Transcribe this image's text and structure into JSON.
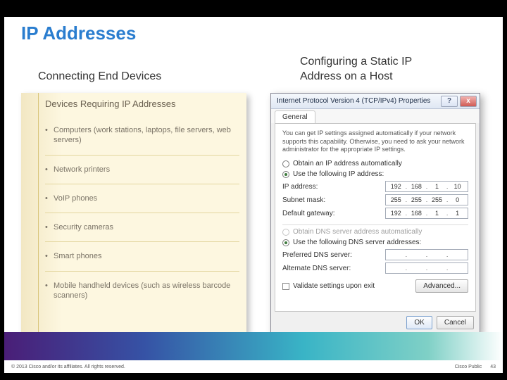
{
  "title": "IP Addresses",
  "subtitle_left": "Connecting End Devices",
  "subtitle_right": "Configuring a Static IP Address on a Host",
  "note": {
    "heading": "Devices Requiring IP Addresses",
    "items": [
      "Computers (work stations, laptops, file servers, web servers)",
      "Network printers",
      "VoIP phones",
      "Security cameras",
      "Smart phones",
      "Mobile handheld devices (such as wireless barcode scanners)"
    ]
  },
  "dialog": {
    "title": "Internet Protocol Version 4 (TCP/IPv4) Properties",
    "close_label": "x",
    "help_label": "?",
    "tab": "General",
    "description": "You can get IP settings assigned automatically if your network supports this capability. Otherwise, you need to ask your network administrator for the appropriate IP settings.",
    "radio_ip_auto": "Obtain an IP address automatically",
    "radio_ip_manual": "Use the following IP address:",
    "ip_label": "IP address:",
    "ip": {
      "a": "192",
      "b": "168",
      "c": "1",
      "d": "10"
    },
    "mask_label": "Subnet mask:",
    "mask": {
      "a": "255",
      "b": "255",
      "c": "255",
      "d": "0"
    },
    "gw_label": "Default gateway:",
    "gw": {
      "a": "192",
      "b": "168",
      "c": "1",
      "d": "1"
    },
    "radio_dns_auto": "Obtain DNS server address automatically",
    "radio_dns_manual": "Use the following DNS server addresses:",
    "dns1_label": "Preferred DNS server:",
    "dns2_label": "Alternate DNS server:",
    "validate_label": "Validate settings upon exit",
    "advanced": "Advanced...",
    "ok": "OK",
    "cancel": "Cancel"
  },
  "footer": {
    "copyright": "© 2013 Cisco and/or its affiliates. All rights reserved.",
    "classification": "Cisco Public",
    "page": "43"
  }
}
